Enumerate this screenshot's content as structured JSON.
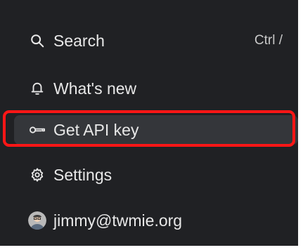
{
  "menu": {
    "search": {
      "label": "Search",
      "shortcut": "Ctrl /",
      "icon": "search-icon"
    },
    "whats_new": {
      "label": "What's new",
      "icon": "bell-icon"
    },
    "get_api_key": {
      "label": "Get API key",
      "icon": "key-icon",
      "selected": true
    },
    "settings": {
      "label": "Settings",
      "icon": "gear-icon"
    },
    "account": {
      "label": "jimmy@twmie.org",
      "icon": "avatar"
    }
  },
  "colors": {
    "panel_bg": "#202124",
    "selected_bg": "#34363a",
    "text": "#e8e8e8",
    "highlight": "#ff1616"
  }
}
